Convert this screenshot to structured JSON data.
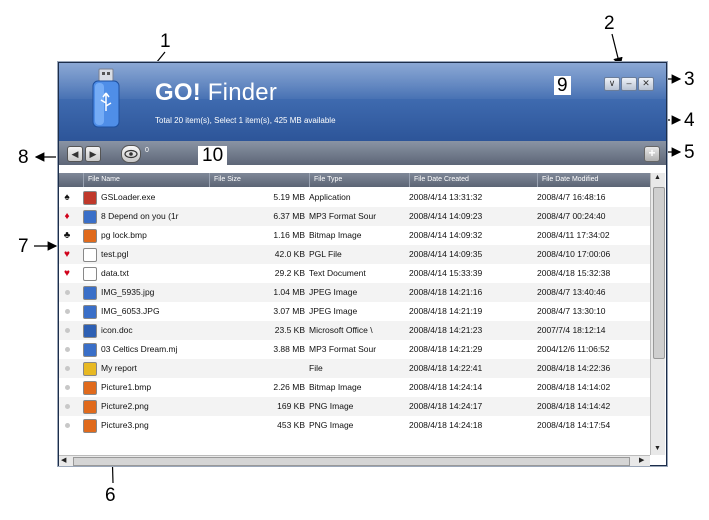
{
  "app": {
    "title_bold": "GO!",
    "title_rest": " Finder",
    "status": "Total 20 item(s), Select 1 item(s), 425 MB available"
  },
  "window_buttons": [
    "∨",
    "–",
    "✕"
  ],
  "toolbar": {
    "back": "◀",
    "forward": "▶",
    "add": "+",
    "field_text": "0"
  },
  "table": {
    "columns": [
      "File Name",
      "File Size",
      "File Type",
      "File Date Created",
      "File Date Modified"
    ],
    "rows": [
      {
        "mark": "♠",
        "mark_color": "#111111",
        "icon_color": "#c0392b",
        "name": "GSLoader.exe",
        "size": "5.19 MB",
        "type": "Application",
        "created": "2008/4/14 13:31:32",
        "modified": "2008/4/7 16:48:16"
      },
      {
        "mark": "♦",
        "mark_color": "#d0021b",
        "icon_color": "#3a6fc8",
        "name": "8 Depend on you (1r",
        "size": "6.37 MB",
        "type": "MP3 Format Sour",
        "created": "2008/4/14 14:09:23",
        "modified": "2008/4/7 00:24:40"
      },
      {
        "mark": "♣",
        "mark_color": "#111111",
        "icon_color": "#e06a1c",
        "name": "pg lock.bmp",
        "size": "1.16 MB",
        "type": "Bitmap Image",
        "created": "2008/4/14 14:09:32",
        "modified": "2008/4/11 17:34:02"
      },
      {
        "mark": "♥",
        "mark_color": "#d0021b",
        "icon_color": "#ffffff",
        "name": "test.pgl",
        "size": "42.0 KB",
        "type": "PGL File",
        "created": "2008/4/14 14:09:35",
        "modified": "2008/4/10 17:00:06"
      },
      {
        "mark": "♥",
        "mark_color": "#d0021b",
        "icon_color": "#ffffff",
        "name": "data.txt",
        "size": "29.2 KB",
        "type": "Text Document",
        "created": "2008/4/14 15:33:39",
        "modified": "2008/4/18 15:32:38"
      },
      {
        "mark": "",
        "mark_color": "#888888",
        "icon_color": "#3a6fc8",
        "name": "IMG_5935.jpg",
        "size": "1.04 MB",
        "type": "JPEG Image",
        "created": "2008/4/18 14:21:16",
        "modified": "2008/4/7 13:40:46"
      },
      {
        "mark": "",
        "mark_color": "#888888",
        "icon_color": "#3a6fc8",
        "name": "IMG_6053.JPG",
        "size": "3.07 MB",
        "type": "JPEG Image",
        "created": "2008/4/18 14:21:19",
        "modified": "2008/4/7 13:30:10"
      },
      {
        "mark": "",
        "mark_color": "#888888",
        "icon_color": "#2d5fb3",
        "name": "icon.doc",
        "size": "23.5 KB",
        "type": "Microsoft Office \\",
        "created": "2008/4/18 14:21:23",
        "modified": "2007/7/4 18:12:14"
      },
      {
        "mark": "",
        "mark_color": "#888888",
        "icon_color": "#3a6fc8",
        "name": "03 Celtics Dream.mj",
        "size": "3.88 MB",
        "type": "MP3 Format Sour",
        "created": "2008/4/18 14:21:29",
        "modified": "2004/12/6 11:06:52"
      },
      {
        "mark": "",
        "mark_color": "#888888",
        "icon_color": "#e8b923",
        "name": "My report",
        "size": "",
        "type": "File",
        "created": "2008/4/18 14:22:41",
        "modified": "2008/4/18 14:22:36"
      },
      {
        "mark": "",
        "mark_color": "#888888",
        "icon_color": "#e06a1c",
        "name": "Picture1.bmp",
        "size": "2.26 MB",
        "type": "Bitmap Image",
        "created": "2008/4/18 14:24:14",
        "modified": "2008/4/18 14:14:02"
      },
      {
        "mark": "",
        "mark_color": "#888888",
        "icon_color": "#e06a1c",
        "name": "Picture2.png",
        "size": "169 KB",
        "type": "PNG Image",
        "created": "2008/4/18 14:24:17",
        "modified": "2008/4/18 14:14:42"
      },
      {
        "mark": "",
        "mark_color": "#888888",
        "icon_color": "#e06a1c",
        "name": "Picture3.png",
        "size": "453 KB",
        "type": "PNG Image",
        "created": "2008/4/18 14:24:18",
        "modified": "2008/4/18 14:17:54"
      }
    ]
  },
  "callouts": [
    "1",
    "2",
    "3",
    "4",
    "5",
    "6",
    "7",
    "8",
    "9",
    "10"
  ]
}
